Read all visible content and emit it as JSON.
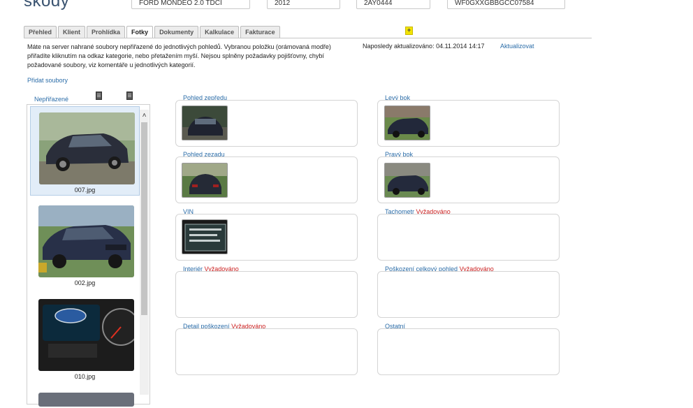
{
  "header": {
    "title": "škody",
    "fields": [
      "FORD MONDEO 2.0 TDCI",
      "2012",
      "2AY0444",
      "WF0GXXGBBGCC07584"
    ]
  },
  "tabs": [
    "Přehled",
    "Klient",
    "Prohlídka",
    "Fotky",
    "Dokumenty",
    "Kalkulace",
    "Fakturace"
  ],
  "active_tab": "Fotky",
  "info_text": "Máte na server nahrané soubory nepřiřazené do jednotlivých pohledů. Vybranou položku (orámovaná modře) přiřadíte kliknutím na odkaz kategorie, nebo přetažením myší. Nejsou splněny požadavky pojišťovny, chybí požadované soubory, viz komentáře u jednotlivých kategorií.",
  "updated": "Naposledy aktualizováno: 04.11.2014 14:17",
  "update_link": "Aktualizovat",
  "add_files": "Přidat soubory",
  "unassigned": {
    "label": "Nepřiřazené",
    "files": [
      "007.jpg",
      "002.jpg",
      "010.jpg"
    ]
  },
  "required_text": "Vyžadováno",
  "categories": {
    "front": {
      "label": "Pohled zepředu",
      "required": false
    },
    "left": {
      "label": "Levý bok",
      "required": false
    },
    "rear": {
      "label": "Pohled zezadu",
      "required": false
    },
    "right": {
      "label": "Pravý bok",
      "required": false
    },
    "vin": {
      "label": "VIN",
      "required": false
    },
    "odometer": {
      "label": "Tachometr",
      "required": true
    },
    "interior": {
      "label": "Interiér",
      "required": true
    },
    "damage_overall": {
      "label": "Poškození celkový pohled",
      "required": true
    },
    "damage_detail": {
      "label": "Detail poškození",
      "required": true
    },
    "other": {
      "label": "Ostatní",
      "required": false
    }
  }
}
